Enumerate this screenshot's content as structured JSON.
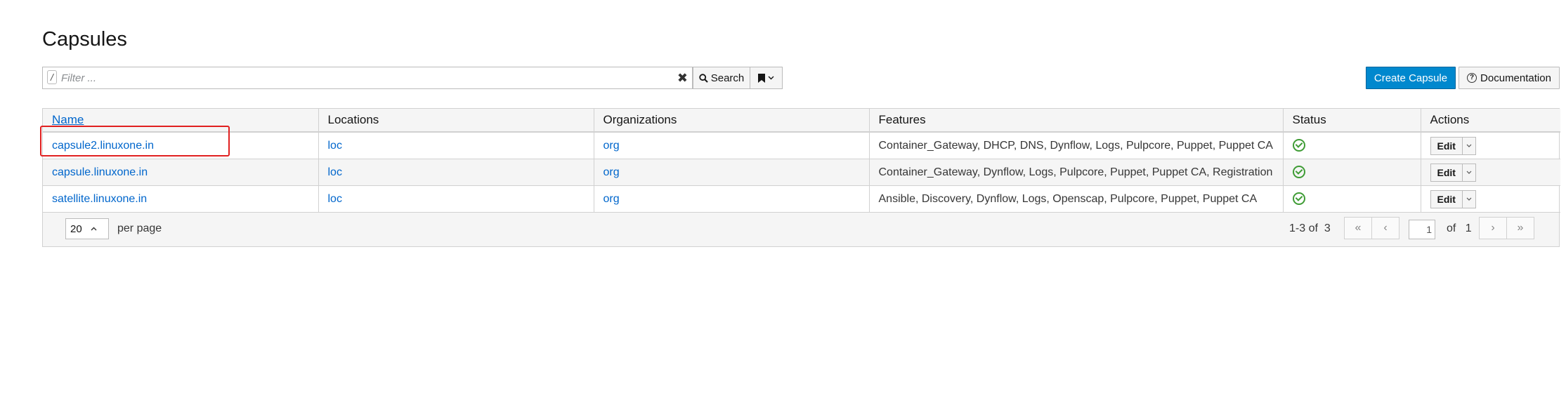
{
  "page": {
    "title": "Capsules"
  },
  "toolbar": {
    "slash": "/",
    "filter_placeholder": "Filter ...",
    "clear": "✖",
    "search_label": "Search",
    "create_label": "Create Capsule",
    "doc_label": "Documentation"
  },
  "table": {
    "headers": [
      "Name",
      "Locations",
      "Organizations",
      "Features",
      "Status",
      "Actions"
    ],
    "rows": [
      {
        "name": "capsule2.linuxone.in",
        "location": "loc",
        "organization": "org",
        "features": "Container_Gateway, DHCP, DNS, Dynflow, Logs, Pulpcore, Puppet, Puppet CA",
        "status": "ok",
        "action": "Edit"
      },
      {
        "name": "capsule.linuxone.in",
        "location": "loc",
        "organization": "org",
        "features": "Container_Gateway, Dynflow, Logs, Pulpcore, Puppet, Puppet CA, Registration",
        "status": "ok",
        "action": "Edit"
      },
      {
        "name": "satellite.linuxone.in",
        "location": "loc",
        "organization": "org",
        "features": "Ansible, Discovery, Dynflow, Logs, Openscap, Pulpcore, Puppet, Puppet CA",
        "status": "ok",
        "action": "Edit"
      }
    ]
  },
  "pagination": {
    "per_page_value": "20",
    "per_page_label": "per page",
    "range": "1-3 of",
    "total": "3",
    "current_page": "1",
    "of_label": "of",
    "total_pages": "1"
  },
  "colors": {
    "accent": "#0088ce",
    "link": "#0066cc",
    "status_ok": "#3f9c35",
    "highlight": "#e02020"
  }
}
